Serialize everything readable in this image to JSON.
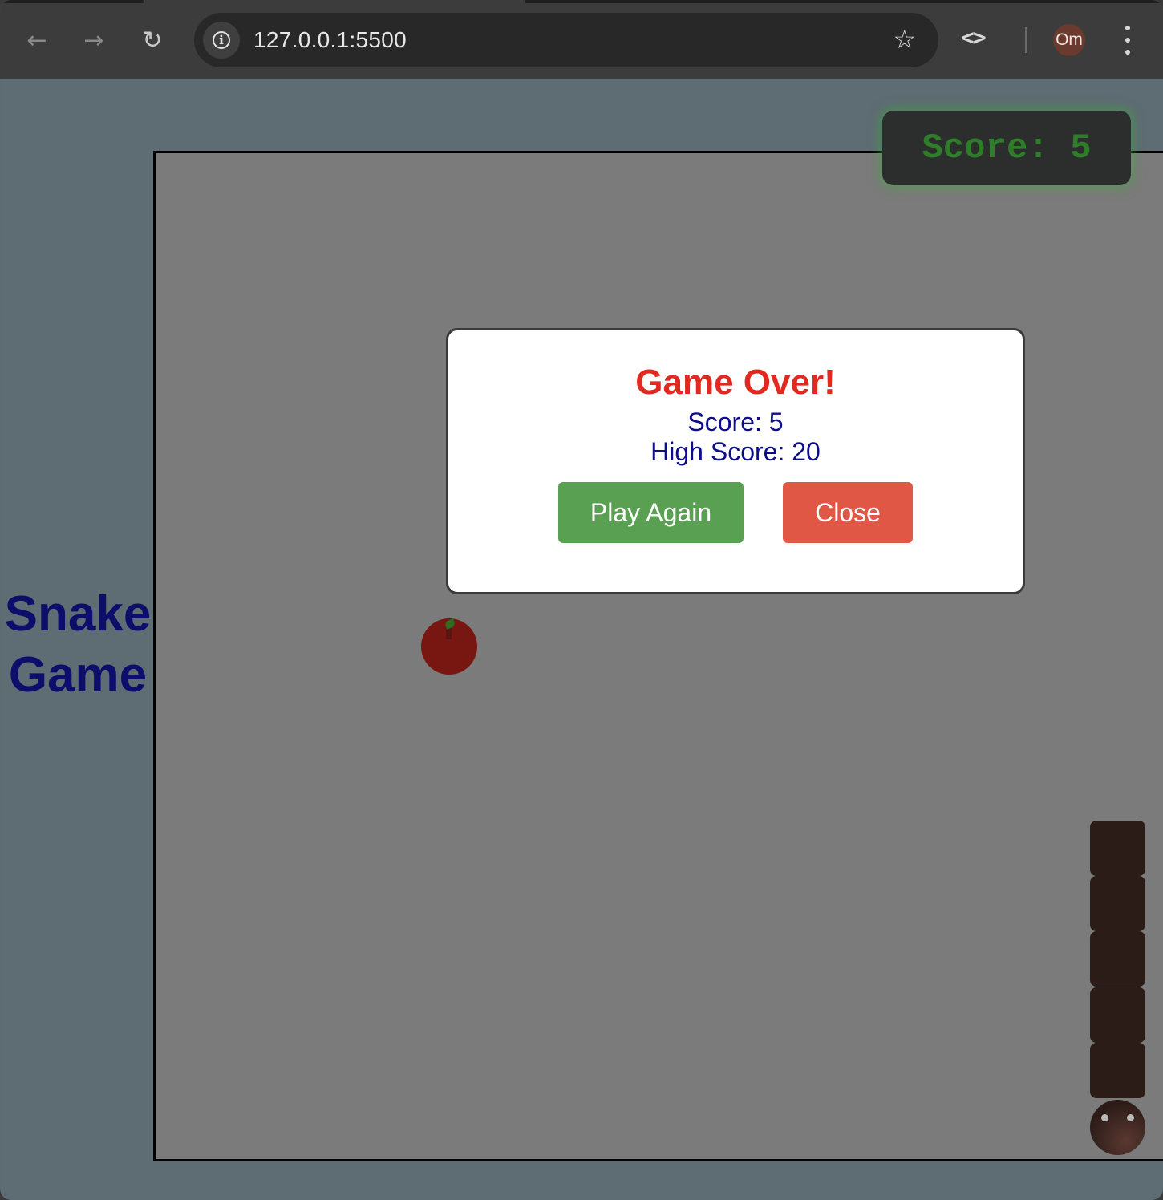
{
  "browser": {
    "url": "127.0.0.1:5500",
    "profile_initials": "Om",
    "icons": {
      "back": "arrow-left-icon",
      "forward": "arrow-right-icon",
      "reload": "reload-icon",
      "site_info": "info-icon",
      "bookmark": "star-icon",
      "devtools": "code-brackets-icon",
      "menu": "kebab-menu-icon"
    }
  },
  "page": {
    "title_line1": "Snake",
    "title_line2": "Game",
    "score_display": "Score: 5"
  },
  "game": {
    "score": 5,
    "snake_body_segments": 5,
    "snake_head": 1,
    "apple_present": true
  },
  "modal": {
    "title": "Game Over!",
    "score_text": "Score: 5",
    "high_score_text": "High Score: 20",
    "play_again_label": "Play Again",
    "close_label": "Close"
  },
  "colors": {
    "page_background": "#5e6c73",
    "board_background": "#7b7b7b",
    "title_color": "#0d0d6b",
    "score_text_color": "#2f7d2a",
    "modal_title_color": "#e0291f",
    "modal_text_color": "#0d0d8a",
    "play_again_button": "#5aa053",
    "close_button": "#e05845",
    "snake_color": "#2c1c18",
    "apple_color": "#781712"
  }
}
